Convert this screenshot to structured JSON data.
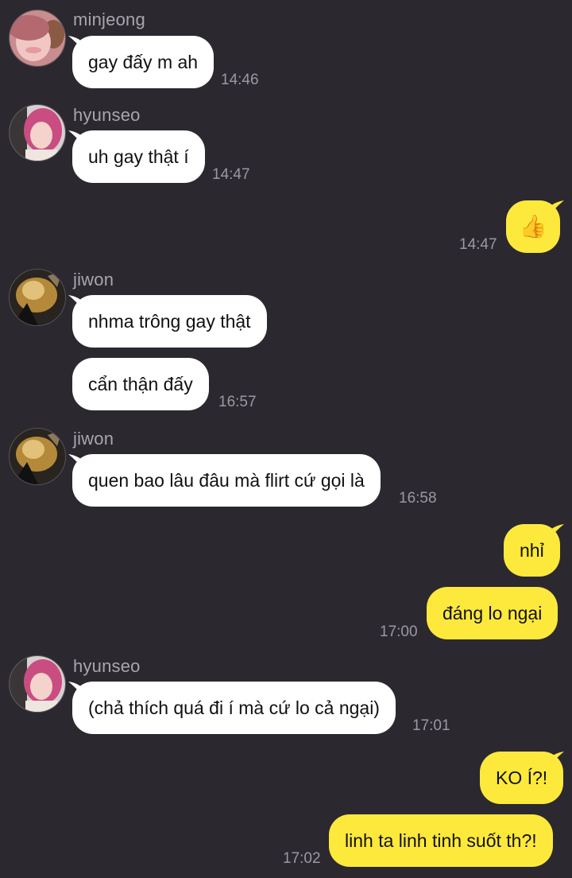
{
  "messages": [
    {
      "sender": "minjeong",
      "text": "gay đấy m ah",
      "time": "14:46"
    },
    {
      "sender": "hyunseo",
      "text": "uh gay thật í",
      "time": "14:47"
    },
    {
      "sender": "me",
      "text": "👍",
      "time": "14:47",
      "emoji": "thumbs-up"
    },
    {
      "sender": "jiwon",
      "text": "nhma trông gay thật"
    },
    {
      "sender": "jiwon",
      "text": "cẩn thận đấy",
      "time": "16:57"
    },
    {
      "sender": "jiwon",
      "text": "quen bao lâu đâu mà flirt cứ gọi là",
      "time": "16:58"
    },
    {
      "sender": "me",
      "text": "nhỉ"
    },
    {
      "sender": "me",
      "text": "đáng lo ngại",
      "time": "17:00"
    },
    {
      "sender": "hyunseo",
      "text": "(chả thích quá đi í mà cứ lo cả ngại)",
      "time": "17:01"
    },
    {
      "sender": "me",
      "text": "KO Í?!"
    },
    {
      "sender": "me",
      "text": "linh ta linh tinh suốt th?!",
      "time": "17:02"
    }
  ],
  "colors": {
    "background": "#2b2830",
    "incoming_bubble": "#ffffff",
    "outgoing_bubble": "#fde93b",
    "sender_name": "#a8a6ad",
    "timestamp": "#9a98a0"
  }
}
